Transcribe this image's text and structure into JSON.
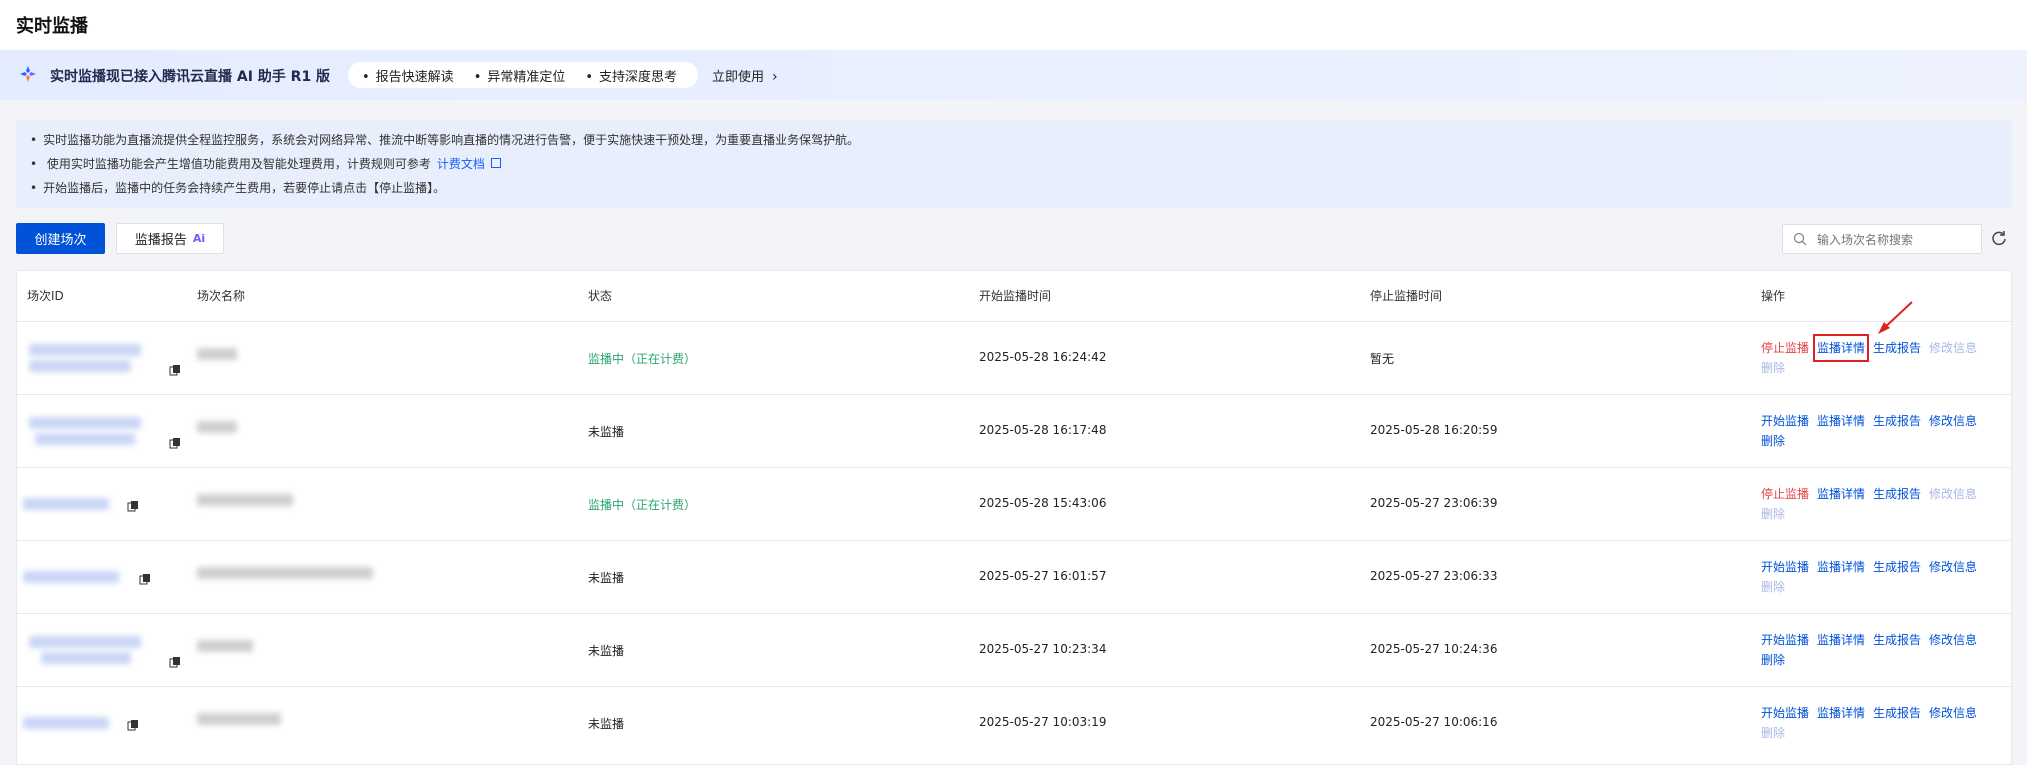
{
  "page": {
    "title": "实时监播"
  },
  "ai_banner": {
    "title": "实时监播现已接入腾讯云直播 AI 助手 R1 版",
    "tags": [
      "报告快速解读",
      "异常精准定位",
      "支持深度思考"
    ],
    "cta": "立即使用"
  },
  "notice": {
    "lines": [
      "实时监播功能为直播流提供全程监控服务，系统会对网络异常、推流中断等影响直播的情况进行告警，便于实施快速干预处理，为重要直播业务保驾护航。",
      "使用实时监播功能会产生增值功能费用及智能处理费用，计费规则可参考",
      "开始监播后，监播中的任务会持续产生费用，若要停止请点击【停止监播】。"
    ],
    "link": "计费文档"
  },
  "toolbar": {
    "create_label": "创建场次",
    "report_label": "监播报告",
    "report_badge": "Ai",
    "search_placeholder": "输入场次名称搜索"
  },
  "table": {
    "headers": [
      "场次ID",
      "场次名称",
      "状态",
      "开始监播时间",
      "停止监播时间",
      "操作"
    ],
    "rows": [
      {
        "status": "监播中（正在计费）",
        "start": "2025-05-28 16:24:42",
        "stop": "暂无",
        "actions": [
          "停止监播",
          "监播详情",
          "生成报告",
          "修改信息",
          "删除"
        ]
      },
      {
        "status": "未监播",
        "start": "2025-05-28 16:17:48",
        "stop": "2025-05-28 16:20:59",
        "actions": [
          "开始监播",
          "监播详情",
          "生成报告",
          "修改信息",
          "删除"
        ]
      },
      {
        "status": "监播中（正在计费）",
        "start": "2025-05-28 15:43:06",
        "stop": "2025-05-27 23:06:39",
        "actions": [
          "停止监播",
          "监播详情",
          "生成报告",
          "修改信息",
          "删除"
        ]
      },
      {
        "status": "未监播",
        "start": "2025-05-27 16:01:57",
        "stop": "2025-05-27 23:06:33",
        "actions": [
          "开始监播",
          "监播详情",
          "生成报告",
          "修改信息",
          "删除"
        ]
      },
      {
        "status": "未监播",
        "start": "2025-05-27 10:23:34",
        "stop": "2025-05-27 10:24:36",
        "actions": [
          "开始监播",
          "监播详情",
          "生成报告",
          "修改信息",
          "删除"
        ]
      },
      {
        "status": "未监播",
        "start": "2025-05-27 10:03:19",
        "stop": "2025-05-27 10:06:16",
        "actions": [
          "开始监播",
          "监播详情",
          "生成报告",
          "修改信息",
          "删除"
        ]
      }
    ]
  }
}
